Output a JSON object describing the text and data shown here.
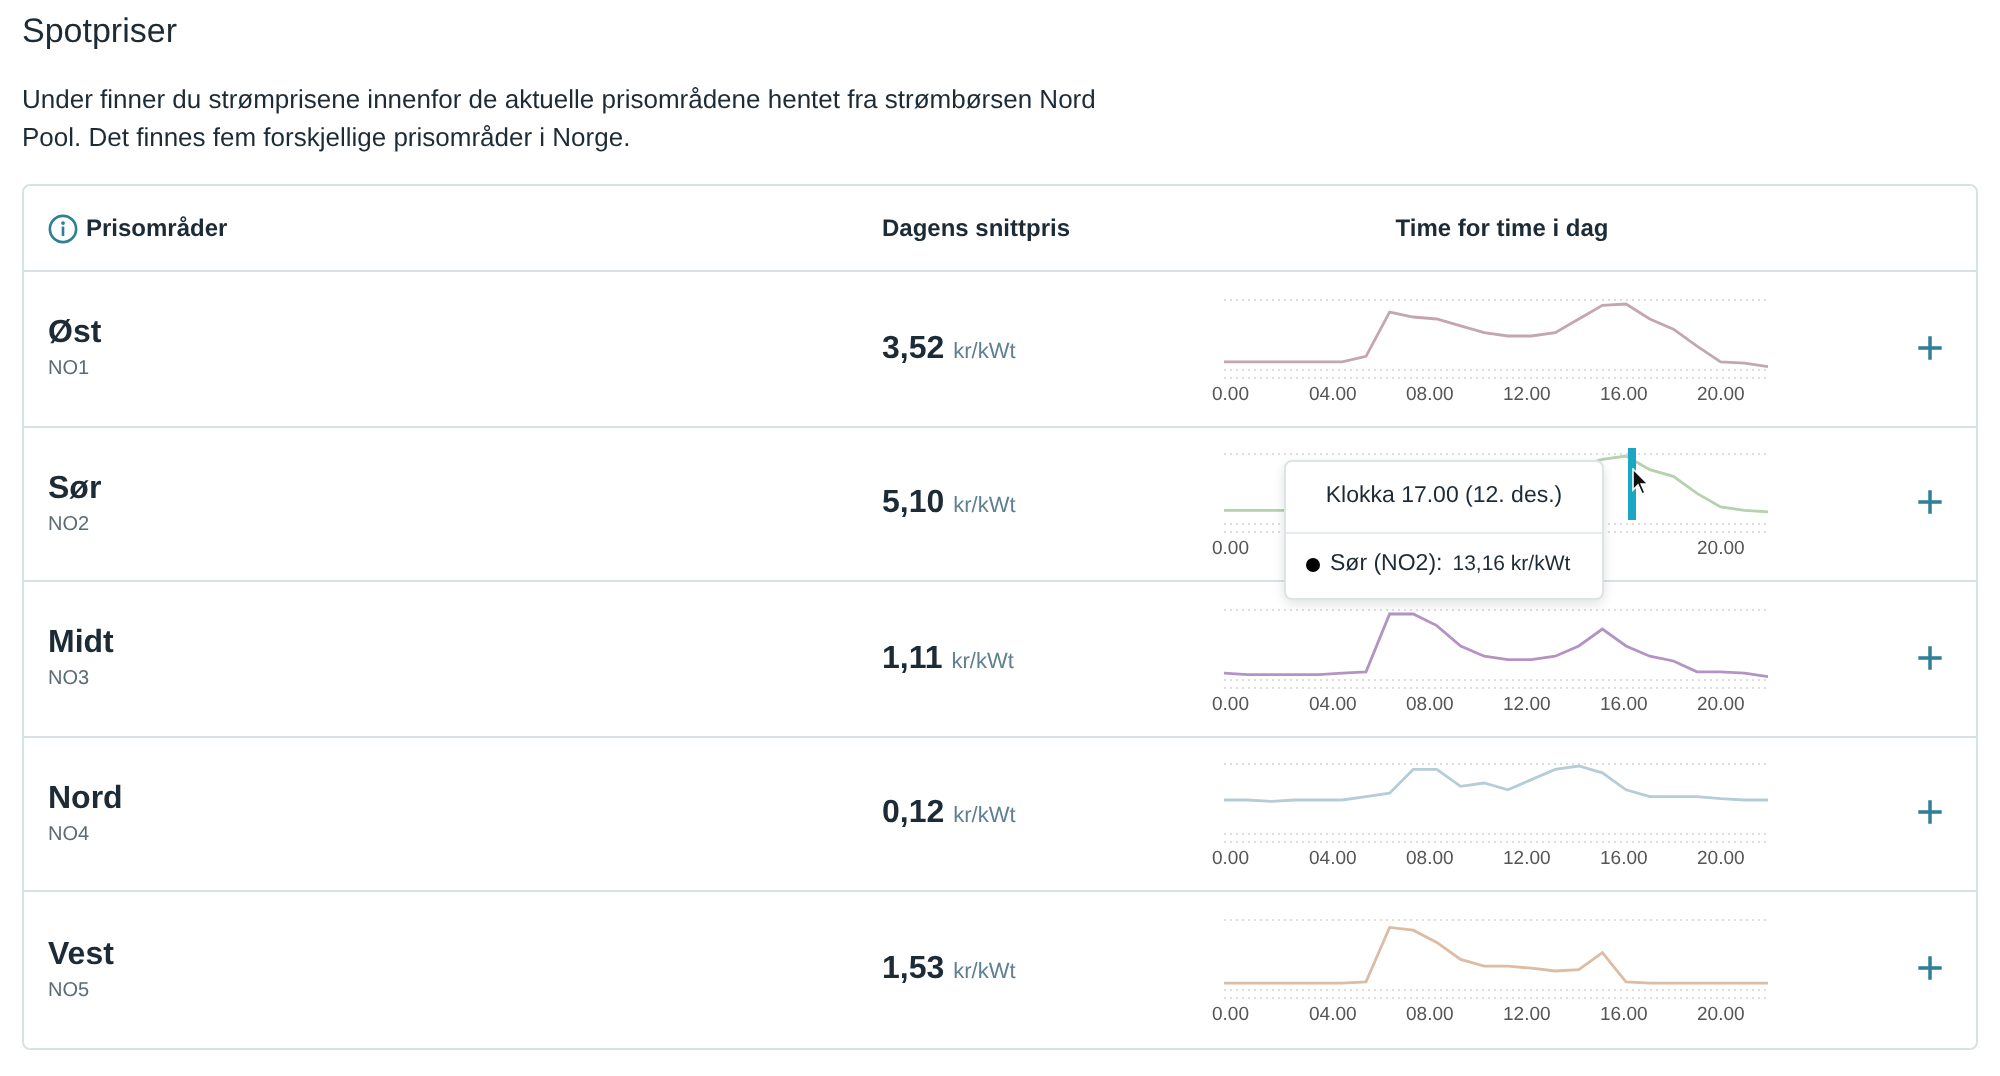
{
  "title": "Spotpriser",
  "intro": "Under finner du strømprisene innenfor de aktuelle prisområdene hentet fra strømbørsen Nord Pool. Det finnes fem forskjellige prisområder i Norge.",
  "table": {
    "columns": [
      "Prisområder",
      "Dagens snittpris",
      "Time for time i dag"
    ],
    "rows": [
      {
        "name": "Øst",
        "code": "NO1",
        "price": "3,52",
        "unit": "kr/kWt",
        "color": "#c4a5b2",
        "ticks": [
          "0.00",
          "04.00",
          "08.00",
          "12.00",
          "16.00",
          "20.00"
        ],
        "expand": "+"
      },
      {
        "name": "Sør",
        "code": "NO2",
        "price": "5,10",
        "unit": "kr/kWt",
        "color": "#b5d1ad",
        "ticks": [
          "0.00",
          "20.00"
        ],
        "expand": "+",
        "tooltip": {
          "title": "Klokka 17.00 (12. des.)",
          "series": "Sør (NO2):",
          "value": "13,16 kr/kWt"
        }
      },
      {
        "name": "Midt",
        "code": "NO3",
        "price": "1,11",
        "unit": "kr/kWt",
        "color": "#b592c4",
        "ticks": [
          "0.00",
          "04.00",
          "08.00",
          "12.00",
          "16.00",
          "20.00"
        ],
        "expand": "+"
      },
      {
        "name": "Nord",
        "code": "NO4",
        "price": "0,12",
        "unit": "kr/kWt",
        "color": "#b4cdd9",
        "ticks": [
          "0.00",
          "04.00",
          "08.00",
          "12.00",
          "16.00",
          "20.00"
        ],
        "expand": "+"
      },
      {
        "name": "Vest",
        "code": "NO5",
        "price": "1,53",
        "unit": "kr/kWt",
        "color": "#dcbca3",
        "ticks": [
          "0.00",
          "04.00",
          "08.00",
          "12.00",
          "16.00",
          "20.00"
        ],
        "expand": "+"
      }
    ]
  }
}
